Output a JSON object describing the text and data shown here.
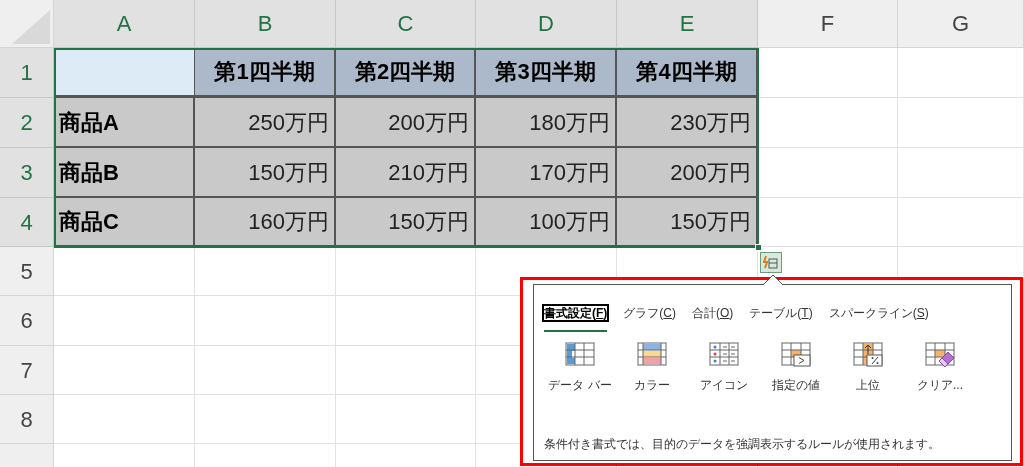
{
  "column_headers": [
    {
      "label": "A",
      "selected": true
    },
    {
      "label": "B",
      "selected": true
    },
    {
      "label": "C",
      "selected": true
    },
    {
      "label": "D",
      "selected": true
    },
    {
      "label": "E",
      "selected": true
    },
    {
      "label": "F",
      "selected": false
    },
    {
      "label": "G",
      "selected": false
    }
  ],
  "row_headers": [
    {
      "label": "1",
      "selected": true
    },
    {
      "label": "2",
      "selected": true
    },
    {
      "label": "3",
      "selected": true
    },
    {
      "label": "4",
      "selected": true
    },
    {
      "label": "5",
      "selected": false
    },
    {
      "label": "6",
      "selected": false
    },
    {
      "label": "7",
      "selected": false
    },
    {
      "label": "8",
      "selected": false
    }
  ],
  "table": {
    "header_row": [
      "第1四半期",
      "第2四半期",
      "第3四半期",
      "第4四半期"
    ],
    "rows": [
      {
        "label": "商品A",
        "values": [
          "250万円",
          "200万円",
          "180万円",
          "230万円"
        ]
      },
      {
        "label": "商品B",
        "values": [
          "150万円",
          "210万円",
          "170万円",
          "200万円"
        ]
      },
      {
        "label": "商品C",
        "values": [
          "160万円",
          "150万円",
          "100万円",
          "150万円"
        ]
      }
    ]
  },
  "quick_analysis": {
    "tabs": [
      {
        "label": "書式設定(F)",
        "selected": true
      },
      {
        "label": "グラフ(C)",
        "selected": false
      },
      {
        "label": "合計(O)",
        "selected": false
      },
      {
        "label": "テーブル(T)",
        "selected": false
      },
      {
        "label": "スパークライン(S)",
        "selected": false
      }
    ],
    "options": [
      {
        "kind": "databar",
        "label": "データ バー"
      },
      {
        "kind": "colorscale",
        "label": "カラー"
      },
      {
        "kind": "iconset",
        "label": "アイコン"
      },
      {
        "kind": "greater",
        "label": "指定の値"
      },
      {
        "kind": "top",
        "label": "上位"
      },
      {
        "kind": "clear",
        "label": "クリア..."
      }
    ],
    "description": "条件付き書式では、目的のデータを強調表示するルールが使用されます。"
  }
}
